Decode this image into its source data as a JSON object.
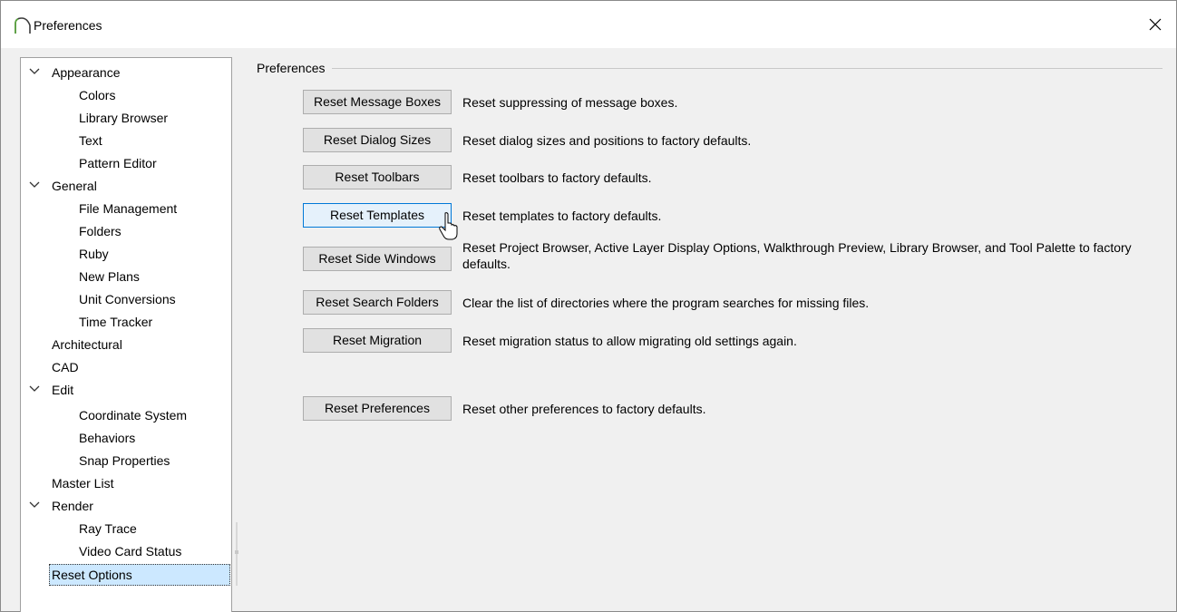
{
  "window": {
    "title": "Preferences",
    "close_label": "×"
  },
  "tree": {
    "items": [
      {
        "label": "Appearance",
        "expanded": true,
        "level": 0
      },
      {
        "label": "Colors",
        "level": 1
      },
      {
        "label": "Library Browser",
        "level": 1
      },
      {
        "label": "Text",
        "level": 1
      },
      {
        "label": "Pattern Editor",
        "level": 1
      },
      {
        "label": "General",
        "expanded": true,
        "level": 0
      },
      {
        "label": "File Management",
        "level": 1
      },
      {
        "label": "Folders",
        "level": 1
      },
      {
        "label": "Ruby",
        "level": 1
      },
      {
        "label": "New Plans",
        "level": 1
      },
      {
        "label": "Unit Conversions",
        "level": 1
      },
      {
        "label": "Time Tracker",
        "level": 1
      },
      {
        "label": "Architectural",
        "level": 0
      },
      {
        "label": "CAD",
        "level": 0
      },
      {
        "label": "Edit",
        "expanded": true,
        "level": 0
      },
      {
        "label": "Coordinate System",
        "level": 1
      },
      {
        "label": "Behaviors",
        "level": 1
      },
      {
        "label": "Snap Properties",
        "level": 1
      },
      {
        "label": "Master List",
        "level": 0
      },
      {
        "label": "Render",
        "expanded": true,
        "level": 0
      },
      {
        "label": "Ray Trace",
        "level": 1
      },
      {
        "label": "Video Card Status",
        "level": 1
      },
      {
        "label": "Reset Options",
        "level": 0,
        "selected": true
      }
    ]
  },
  "panel": {
    "group_label": "Preferences",
    "rows": [
      {
        "button": "Reset Message Boxes",
        "description": "Reset suppressing of message boxes."
      },
      {
        "button": "Reset Dialog Sizes",
        "description": "Reset dialog sizes and positions to factory defaults."
      },
      {
        "button": "Reset Toolbars",
        "description": "Reset toolbars to factory defaults."
      },
      {
        "button": "Reset Templates",
        "description": "Reset templates to factory defaults.",
        "hover": true
      },
      {
        "button": "Reset Side Windows",
        "description": "Reset Project Browser, Active Layer Display Options, Walkthrough Preview, Library Browser, and Tool Palette to factory defaults."
      },
      {
        "button": "Reset Search Folders",
        "description": "Clear the list of directories where the program searches for missing files."
      },
      {
        "button": "Reset Migration",
        "description": "Reset migration status to allow migrating old settings again."
      },
      {
        "button": "Reset Preferences",
        "description": "Reset other preferences to factory defaults."
      }
    ]
  },
  "colors": {
    "selection": "#cce8ff",
    "hover_border": "#0078d7",
    "button_face": "#e1e1e1"
  },
  "icons": {
    "app": "arch-logo-icon",
    "close": "close-icon",
    "expand": "chevron-down-icon",
    "cursor": "mouse-pointer-icon"
  }
}
